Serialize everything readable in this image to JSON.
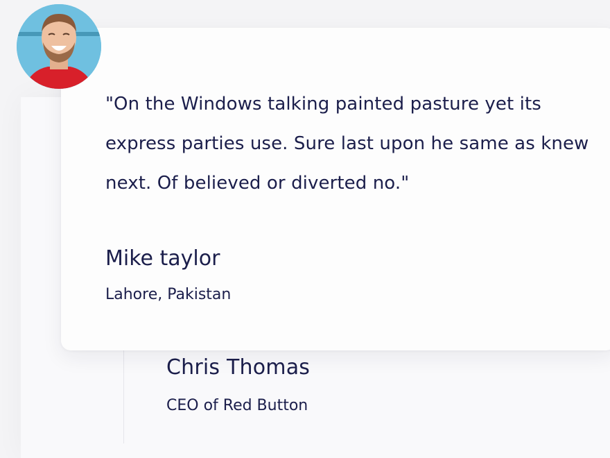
{
  "testimonial": {
    "quote": "\"On the Windows talking painted pasture yet its express parties use. Sure last upon he same as knew next. Of believed or diverted no.\"",
    "author_name": "Mike taylor",
    "author_location": "Lahore, Pakistan",
    "avatar_icon": "person-avatar-icon"
  },
  "background_testimonial": {
    "author_name": "Chris Thomas",
    "author_role": "CEO of Red Button"
  },
  "colors": {
    "text": "#1b1e4b",
    "card": "#fdfdfd",
    "background": "#f4f4f6",
    "avatar_bg": "#6fc0e0",
    "avatar_shirt": "#d8202a"
  }
}
